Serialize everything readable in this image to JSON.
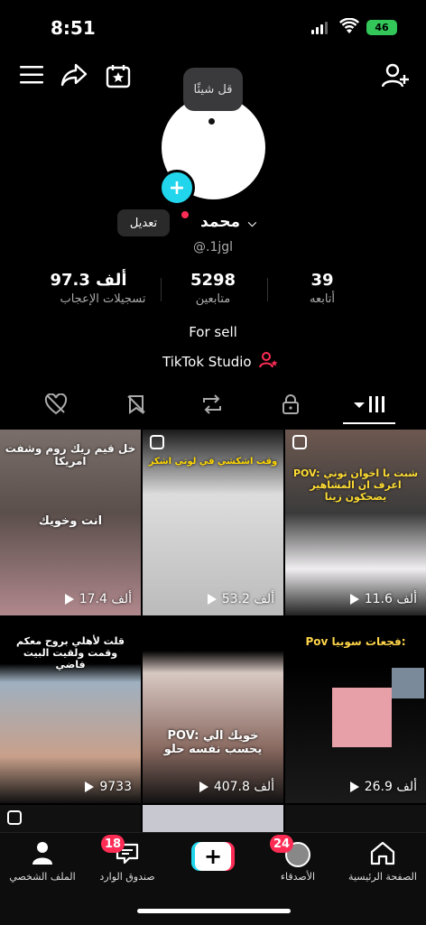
{
  "status_bar": {
    "time": "8:51",
    "battery": "46"
  },
  "tooltip": {
    "text": "قل شيئًا"
  },
  "profile": {
    "name": "محمد",
    "username": "@.1jgl",
    "edit_label": "تعديل",
    "stats": [
      {
        "value": "97.3 ألف",
        "label": "تسجيلات الإعجاب"
      },
      {
        "value": "5298",
        "label": "متابعين"
      },
      {
        "value": "39",
        "label": "أتابعه"
      }
    ],
    "bio": "For sell",
    "studio_link": "TikTok Studio"
  },
  "videos": [
    {
      "caption": "خل قيم ريك روم وشفت امريكا",
      "caption2": "انت وخويك",
      "views": "17.4 ألف",
      "pinned": false
    },
    {
      "caption": "وقت اشكشي في لوتي اشكر",
      "caption2": "",
      "views": "53.2 ألف",
      "pinned": true
    },
    {
      "caption": "POV: شبت يا اخوان توني اعرف ان المشاهير يضحكون زينا",
      "caption2": "",
      "views": "11.6 ألف",
      "pinned": true
    },
    {
      "caption": "قلت لأهلي بروح معكم وقمت ولقيت البيت فاضي",
      "caption2": "",
      "views": "9733",
      "pinned": false
    },
    {
      "caption": "POV: خويك الي يحسب نفسه حلو",
      "caption2": "",
      "views": "407.8 ألف",
      "pinned": false
    },
    {
      "caption": "Pov فجعات سوبيا:",
      "caption2": "",
      "views": "26.9 ألف",
      "pinned": false
    }
  ],
  "nav": {
    "profile": "الملف الشخصي",
    "inbox": "صندوق الوارد",
    "inbox_badge": "18",
    "friends": "الأصدقاء",
    "friends_badge": "24",
    "home": "الصفحة الرئيسية",
    "create_icon": "plus-icon"
  },
  "colors": {
    "accent": "#fe2c55",
    "cyan": "#20d5ec"
  }
}
